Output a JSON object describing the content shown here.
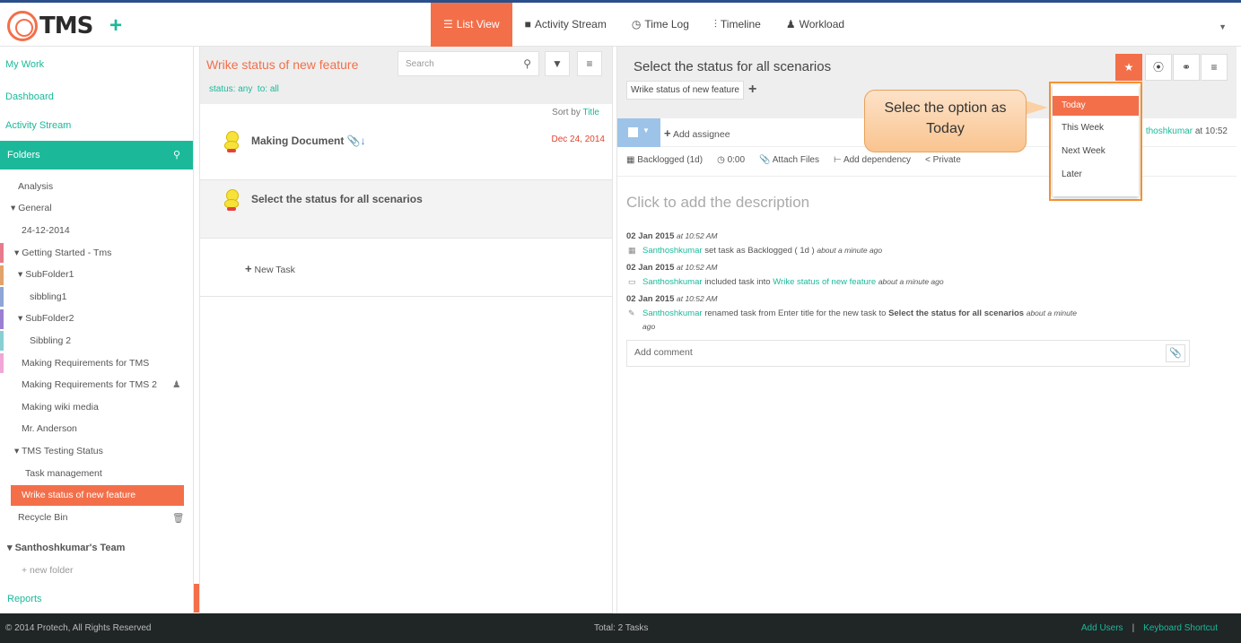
{
  "header": {
    "logo_text": "TMS",
    "add_symbol": "+",
    "nav": [
      {
        "label": "List View",
        "icon": "list-icon",
        "active": true
      },
      {
        "label": "Activity Stream",
        "icon": "comment-icon",
        "active": false
      },
      {
        "label": "Time Log",
        "icon": "clock-icon",
        "active": false
      },
      {
        "label": "Timeline",
        "icon": "sliders-icon",
        "active": false
      },
      {
        "label": "Workload",
        "icon": "user-icon",
        "active": false
      }
    ]
  },
  "sidebar": {
    "my_work": "My Work",
    "dashboard": "Dashboard",
    "activity_stream": "Activity Stream",
    "folders": "Folders",
    "tree": [
      "Analysis",
      "General",
      "24-12-2014",
      "Getting Started - Tms",
      "SubFolder1",
      "sibbling1",
      "SubFolder2",
      "Sibbling 2",
      "Making Requirements for TMS",
      "Making Requirements for TMS 2",
      "Making wiki media",
      "Mr. Anderson",
      "TMS Testing Status",
      "Task management",
      "Wrike status of new feature",
      "Recycle Bin"
    ],
    "team": "Santhoshkumar's Team",
    "new_folder": "+ new folder",
    "reports": "Reports"
  },
  "middle": {
    "title": "Wrike status of new feature",
    "search_placeholder": "Search",
    "status_filter": "status: any",
    "to_filter": "to: all",
    "sort_label": "Sort by",
    "sort_value": "Title",
    "tasks": [
      {
        "title": "Making Document",
        "date": "Dec 24, 2014"
      },
      {
        "title": "Select the status for all scenarios",
        "date": ""
      }
    ],
    "new_task": "New Task"
  },
  "detail": {
    "title": "Select the status for all scenarios",
    "folder_tag": "Wrike status of new feature",
    "add_assignee": "Add assignee",
    "author_name": "thoshkumar",
    "author_time": "at 10:52",
    "meta": {
      "status": "Backlogged (1d)",
      "time": "0:00",
      "attach": "Attach Files",
      "dependency": "Add dependency",
      "privacy": "Private"
    },
    "description_placeholder": "Click to add the description",
    "activity": [
      {
        "date": "02 Jan 2015",
        "time": "at 10:52 AM",
        "user": "Santhoshkumar",
        "text": "set task as Backlogged ( 1d )",
        "link": "",
        "bold": "",
        "ago": "about a minute ago"
      },
      {
        "date": "02 Jan 2015",
        "time": "at 10:52 AM",
        "user": "Santhoshkumar",
        "text": "included task into",
        "link": "Wrike status of new feature",
        "bold": "",
        "ago": "about a minute ago"
      },
      {
        "date": "02 Jan 2015",
        "time": "at 10:52 AM",
        "user": "Santhoshkumar",
        "text": "renamed task from Enter title for the new task to",
        "link": "",
        "bold": "Select the status for all scenarios",
        "ago": "about a minute ago"
      }
    ],
    "comment_placeholder": "Add comment"
  },
  "dropdown": {
    "options": [
      "Today",
      "This Week",
      "Next Week",
      "Later"
    ],
    "selected": "Today"
  },
  "callout": {
    "line1": "Selec the option as",
    "line2": "Today"
  },
  "footer": {
    "copyright": "© 2014 Protech, All Rights Reserved",
    "total": "Total: 2 Tasks",
    "add_users": "Add Users",
    "separator": "|",
    "shortcut": "Keyboard Shortcut"
  },
  "colors": {
    "accent": "#f36f4a",
    "teal": "#1bb99a",
    "footer_bg": "#202526"
  }
}
